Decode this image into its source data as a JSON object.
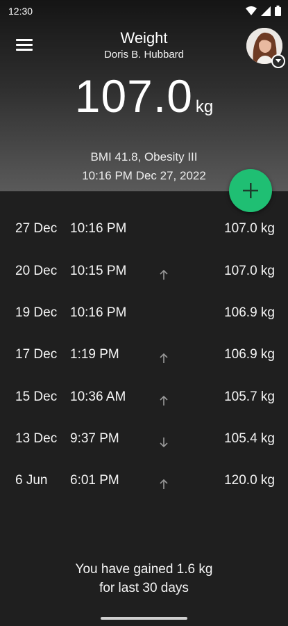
{
  "status_bar": {
    "time": "12:30"
  },
  "header": {
    "title": "Weight",
    "user_name": "Doris B. Hubbard",
    "weight_value": "107.0",
    "weight_unit": "kg",
    "bmi": "BMI 41.8, Obesity III",
    "datetime": "10:16 PM Dec 27, 2022"
  },
  "icons": {
    "menu": "menu-icon",
    "avatar": "user-avatar",
    "avatar_badge": "chevron-down-icon",
    "add": "plus-icon",
    "trend_up": "arrow-up-icon",
    "trend_down": "arrow-down-icon"
  },
  "colors": {
    "accent": "#1fbf73",
    "background": "#1f1f1f"
  },
  "entries": [
    {
      "date": "27 Dec",
      "time": "10:16 PM",
      "trend": "none",
      "weight": "107.0 kg"
    },
    {
      "date": "20 Dec",
      "time": "10:15 PM",
      "trend": "up",
      "weight": "107.0 kg"
    },
    {
      "date": "19 Dec",
      "time": "10:16 PM",
      "trend": "none",
      "weight": "106.9 kg"
    },
    {
      "date": "17 Dec",
      "time": "1:19 PM",
      "trend": "up",
      "weight": "106.9 kg"
    },
    {
      "date": "15 Dec",
      "time": "10:36 AM",
      "trend": "up",
      "weight": "105.7 kg"
    },
    {
      "date": "13 Dec",
      "time": "9:37 PM",
      "trend": "down",
      "weight": "105.4 kg"
    },
    {
      "date": "6 Jun",
      "time": "6:01 PM",
      "trend": "up",
      "weight": "120.0 kg"
    }
  ],
  "summary": {
    "line1": "You have gained 1.6 kg",
    "line2": "for last 30 days"
  }
}
